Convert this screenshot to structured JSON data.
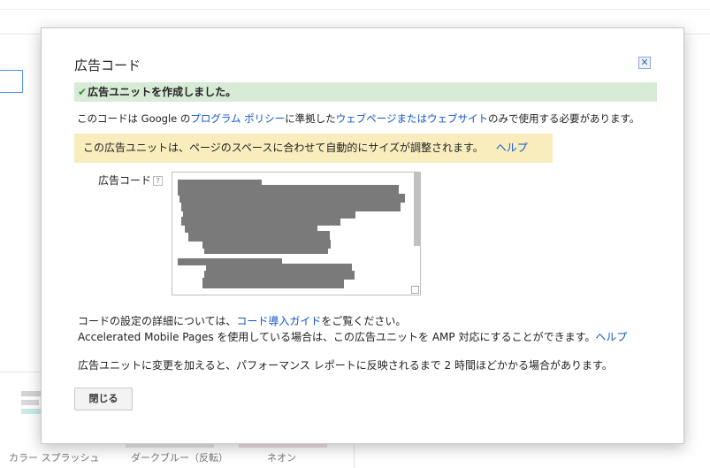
{
  "background": {
    "captions": [
      "カラー スプラッシュ",
      "ダークブルー（反転）",
      "ネオン"
    ]
  },
  "dialog": {
    "title": "広告コード",
    "close_icon": "close-icon",
    "success_message": "広告ユニットを作成しました。",
    "policy": {
      "prefix": "このコードは Google の",
      "link1": "プログラム ポリシー",
      "middle": "に準拠した",
      "link2": "ウェブページまたはウェブサイト",
      "suffix": "のみで使用する必要があります。"
    },
    "notice": {
      "text": "この広告ユニットは、ページのスペースに合わせて自動的にサイズが調整されます。",
      "help_link": "ヘルプ"
    },
    "code_label": "広告コード",
    "help_icon": "?",
    "info": {
      "line1_prefix": "コードの設定の詳細については、",
      "line1_link": "コード導入ガイド",
      "line1_suffix": "をご覧ください。",
      "line2_text": "Accelerated Mobile Pages を使用している場合は、この広告ユニットを AMP 対応にすることができます。",
      "line2_link": "ヘルプ",
      "line3": "広告ユニットに変更を加えると、パフォーマンス レポートに反映されるまで 2 時間ほどかかる場合があります。"
    },
    "close_button": "閉じる"
  },
  "colors": {
    "success_bg": "#d8ebd6",
    "notice_bg": "#f9edbe",
    "link": "#1155cc",
    "redaction": "#7a7a7a"
  }
}
